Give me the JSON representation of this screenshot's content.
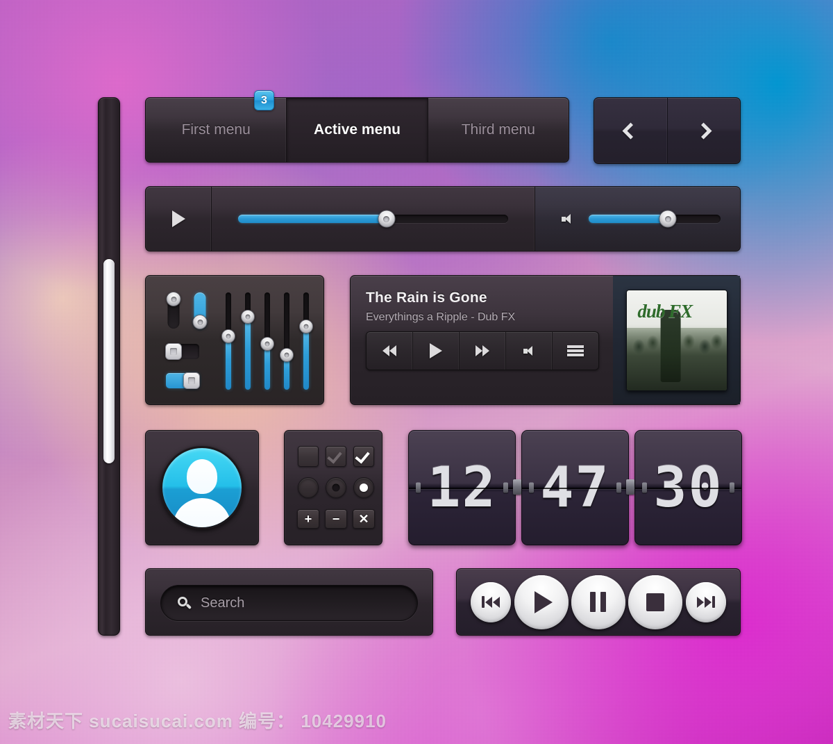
{
  "menu": {
    "badge": "3",
    "items": [
      {
        "label": "First menu",
        "active": false
      },
      {
        "label": "Active menu",
        "active": true
      },
      {
        "label": "Third menu",
        "active": false
      }
    ]
  },
  "nav": {
    "prev_icon": "chevron-left-icon",
    "next_icon": "chevron-right-icon"
  },
  "player_bar": {
    "play_icon": "play-icon",
    "progress_percent": 55,
    "volume_icon": "speaker-icon",
    "volume_percent": 60
  },
  "equalizer": {
    "mini_sliders": [
      {
        "name": "mini-slider-off",
        "state": "off",
        "knob_top_percent": 0
      },
      {
        "name": "mini-slider-on",
        "state": "on",
        "knob_top_percent": 60
      }
    ],
    "toggles": [
      {
        "name": "toggle-off",
        "state": "off"
      },
      {
        "name": "toggle-on",
        "state": "on"
      }
    ],
    "bands": [
      45,
      25,
      53,
      64,
      35
    ]
  },
  "now_playing": {
    "title": "The Rain is Gone",
    "artist": "Everythings a Ripple - Dub FX",
    "album_art_label": "dub FX",
    "controls": [
      {
        "name": "rewind-button",
        "icon": "rewind-icon"
      },
      {
        "name": "play-button",
        "icon": "play-icon"
      },
      {
        "name": "fast-forward-button",
        "icon": "fast-forward-icon"
      },
      {
        "name": "mute-button",
        "icon": "speaker-icon"
      },
      {
        "name": "playlist-button",
        "icon": "hamburger-menu-icon"
      }
    ]
  },
  "avatar": {
    "icon": "user-avatar-icon"
  },
  "controls_grid": {
    "checkboxes": [
      {
        "name": "checkbox-unchecked",
        "state": "unchecked"
      },
      {
        "name": "checkbox-checked-dim",
        "state": "checked-dim"
      },
      {
        "name": "checkbox-checked",
        "state": "checked"
      }
    ],
    "radios": [
      {
        "name": "radio-unselected",
        "state": "unselected"
      },
      {
        "name": "radio-selected-dim",
        "state": "selected-dim"
      },
      {
        "name": "radio-selected",
        "state": "selected"
      }
    ],
    "buttons": [
      {
        "name": "add-button",
        "label": "+"
      },
      {
        "name": "remove-button",
        "label": "−"
      },
      {
        "name": "close-button",
        "label": "✕"
      }
    ]
  },
  "clock": {
    "hours": "12",
    "minutes": "47",
    "seconds": "30"
  },
  "search": {
    "placeholder": "Search",
    "value": "",
    "icon": "search-icon"
  },
  "transport": {
    "buttons": [
      {
        "name": "previous-track-button",
        "icon": "previous-icon",
        "size": "sm"
      },
      {
        "name": "play-button",
        "icon": "play-icon",
        "size": "lg"
      },
      {
        "name": "pause-button",
        "icon": "pause-icon",
        "size": "lg"
      },
      {
        "name": "stop-button",
        "icon": "stop-icon",
        "size": "lg"
      },
      {
        "name": "next-track-button",
        "icon": "next-icon",
        "size": "lg"
      }
    ]
  },
  "scrollbar": {
    "thumb_top_percent": 30,
    "thumb_height_percent": 38
  },
  "watermark": "素材天下 sucaisucai.com  编号： 10429910",
  "colors": {
    "accent_blue": "#2d9dd8",
    "panel_dark": "#2d262d",
    "text_primary": "#ffffff",
    "text_muted": "#9d919d",
    "badge_blue": "#2da3df"
  }
}
